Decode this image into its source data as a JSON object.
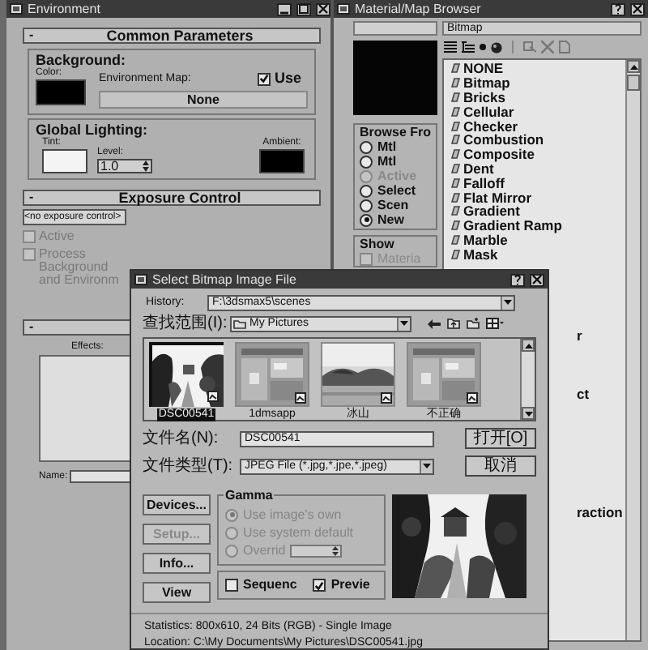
{
  "environment_window": {
    "title": "Environment",
    "common_parameters": {
      "collapse": "-",
      "header": "Common Parameters",
      "background_label": "Background:",
      "color_label": "Color:",
      "environment_map_label": "Environment Map:",
      "use_map": {
        "label": "Use",
        "checked": true
      },
      "map_button": "None",
      "global_lighting_label": "Global Lighting:",
      "tint_label": "Tint:",
      "level_label": "Level:",
      "level_value": "1.0",
      "ambient_label": "Ambient:"
    },
    "exposure_control": {
      "collapse": "-",
      "header": "Exposure Control",
      "dropdown": "<no exposure control>",
      "options": [
        {
          "label": "Active",
          "checked": false,
          "disabled": true
        },
        {
          "label": "Process Background and Environm",
          "checked": false,
          "disabled": true
        }
      ]
    },
    "effects": {
      "collapse": "-",
      "label": "Effects:",
      "name_label": "Name:"
    }
  },
  "material_browser": {
    "title": "Material/Map Browser",
    "name_field": "Bitmap",
    "browse_from": {
      "label": "Browse Fro",
      "options": [
        {
          "label": "Mtl",
          "selected": false,
          "disabled": false
        },
        {
          "label": "Mtl",
          "selected": false,
          "disabled": false
        },
        {
          "label": "Active",
          "selected": false,
          "disabled": true
        },
        {
          "label": "Select",
          "selected": false,
          "disabled": false
        },
        {
          "label": "Scen",
          "selected": false,
          "disabled": false
        },
        {
          "label": "New",
          "selected": true,
          "disabled": false
        }
      ]
    },
    "show": {
      "label": "Show",
      "options": [
        {
          "label": "Materia",
          "checked": false,
          "disabled": true
        }
      ]
    },
    "maps": [
      "NONE",
      "Bitmap",
      "Bricks",
      "Cellular",
      "Checker",
      "Combustion",
      "Composite",
      "Dent",
      "Falloff",
      "Flat Mirror",
      "Gradient",
      "Gradient Ramp",
      "Marble",
      "Mask"
    ],
    "partial_maps": [
      "r",
      "ct",
      "raction"
    ]
  },
  "file_dialog": {
    "title": "Select Bitmap Image File",
    "history_label": "History:",
    "history_value": "F:\\3dsmax5\\scenes",
    "look_in_label": "查找范围(I):",
    "look_in_value": "My Pictures",
    "files": [
      {
        "name": "DSC00541",
        "selected": true
      },
      {
        "name": "1dmsapp",
        "selected": false
      },
      {
        "name": "冰山",
        "selected": false
      },
      {
        "name": "不正确",
        "selected": false
      }
    ],
    "file_name_label": "文件名(N):",
    "file_name_value": "DSC00541",
    "file_type_label": "文件类型(T):",
    "file_type_value": "JPEG File (*.jpg,*.jpe,*.jpeg)",
    "open_button": "打开[O]",
    "cancel_button": "取消",
    "side_buttons": [
      {
        "label": "Devices...",
        "disabled": false
      },
      {
        "label": "Setup...",
        "disabled": true
      },
      {
        "label": "Info...",
        "disabled": false
      },
      {
        "label": "View",
        "disabled": false
      }
    ],
    "gamma": {
      "label": "Gamma",
      "options": [
        {
          "label": "Use image's own",
          "selected": true,
          "disabled": true
        },
        {
          "label": "Use system default",
          "selected": false,
          "disabled": true
        },
        {
          "label": "Overrid",
          "selected": false,
          "disabled": true
        }
      ]
    },
    "sequence": {
      "label": "Sequenc",
      "checked": false
    },
    "preview": {
      "label": "Previe",
      "checked": true
    },
    "statistics": "Statistics:  800x610, 24 Bits (RGB) - Single Image",
    "location": "Location:  C:\\My Documents\\My Pictures\\DSC00541.jpg"
  }
}
